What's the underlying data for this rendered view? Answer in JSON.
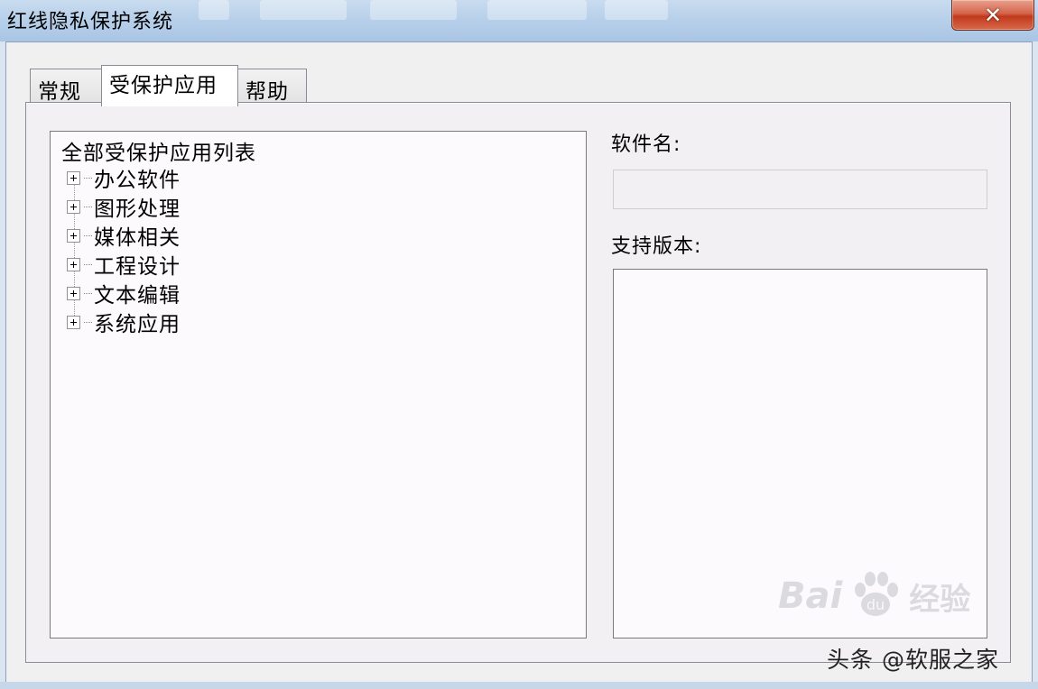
{
  "window": {
    "title": "红线隐私保护系统",
    "close_glyph": "✕"
  },
  "tabs": [
    {
      "label": "常规",
      "active": false
    },
    {
      "label": "受保护应用",
      "active": true
    },
    {
      "label": "帮助",
      "active": false
    }
  ],
  "tree": {
    "root_label": "全部受保护应用列表",
    "items": [
      {
        "label": "办公软件",
        "icon": "expand-plus-icon"
      },
      {
        "label": "图形处理",
        "icon": "expand-plus-icon"
      },
      {
        "label": "媒体相关",
        "icon": "expand-plus-icon"
      },
      {
        "label": "工程设计",
        "icon": "expand-plus-icon"
      },
      {
        "label": "文本编辑",
        "icon": "expand-plus-icon"
      },
      {
        "label": "系统应用",
        "icon": "expand-plus-icon"
      }
    ]
  },
  "details": {
    "software_name_label": "软件名:",
    "software_name_value": "",
    "supported_versions_label": "支持版本:",
    "supported_versions_value": ""
  },
  "watermarks": {
    "baidu_text": "Bai",
    "baidu_suffix": "du",
    "baidu_cn": "经验",
    "toutiao": "头条 @软服之家"
  },
  "colors": {
    "titlebar": "#b8d0ea",
    "close_button": "#c2391d",
    "panel_bg": "#f3f0f3"
  }
}
